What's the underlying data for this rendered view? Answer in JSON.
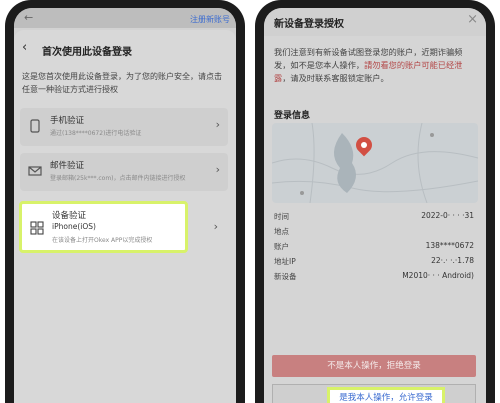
{
  "left": {
    "top_link": "注册新账号",
    "title": "首次使用此设备登录",
    "description": "这是您首次使用此设备登录，为了您的账户安全，请点击任意一种验证方式进行授权",
    "options": [
      {
        "name": "手机验证",
        "sub": "通过(138****0672)进行电话验证"
      },
      {
        "name": "邮件验证",
        "sub": "登录邮箱(25k***.com)，点击邮件内链接进行授权"
      }
    ],
    "device_option": {
      "name": "设备验证",
      "device": "iPhone(iOS)",
      "sub": "在该设备上打开Okex APP以完成授权"
    }
  },
  "right": {
    "title": "新设备登录授权",
    "desc_normal": "我们注意到有新设备试图登录您的账户，近期诈骗频发，如不是您本人操作，",
    "desc_warning": "請勿看您的账户可能已经泄露",
    "desc_end": "，请及时联系客服锁定账户。",
    "section_title": "登录信息",
    "rows": [
      {
        "key": "时间",
        "value": "2022-0‧ ‧ ‧ ‧31"
      },
      {
        "key": "地点",
        "value": ""
      },
      {
        "key": "账户",
        "value": "138****0672"
      },
      {
        "key": "地址IP",
        "value": "22‧.‧ ‧.‧1.78"
      },
      {
        "key": "新设备",
        "value": "M2010‧ ‧ ‧ Android)"
      }
    ],
    "deny_button": "不是本人操作，拒绝登录",
    "allow_button": "是我本人操作，允许登录"
  }
}
